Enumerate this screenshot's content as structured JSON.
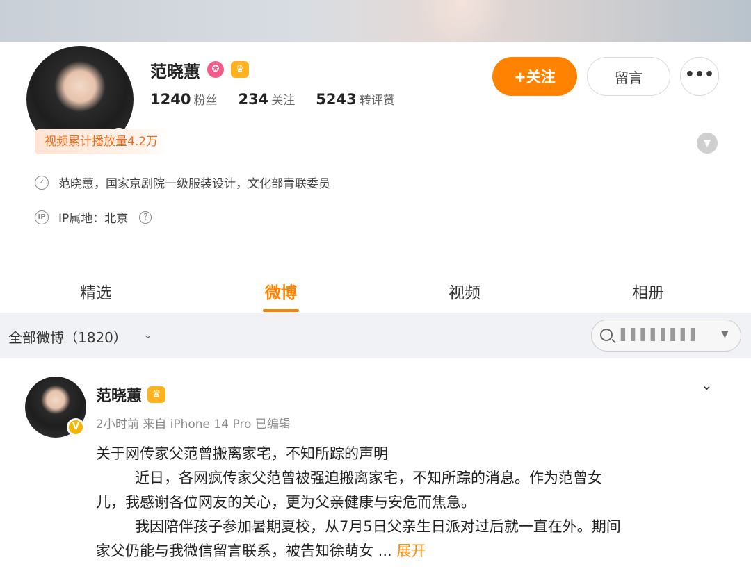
{
  "profile": {
    "name": "范晓蕙",
    "verified_mark": "V",
    "badges": [
      "pink-badge-icon",
      "crown-badge-icon"
    ],
    "stats": [
      {
        "value": "1240",
        "label": "粉丝"
      },
      {
        "value": "234",
        "label": "关注"
      },
      {
        "value": "5243",
        "label": "转评赞"
      }
    ],
    "follow_label": "+关注",
    "message_label": "留言",
    "more_label": "•••",
    "video_plays": "视频累计播放量4.2万",
    "bio": "范晓蕙，国家京剧院一级服装设计，文化部青联委员",
    "ip_location": "IP属地：北京"
  },
  "tabs": [
    {
      "label": "精选"
    },
    {
      "label": "微博"
    },
    {
      "label": "视频"
    },
    {
      "label": "相册"
    }
  ],
  "active_tab": "微博",
  "filter": {
    "label": "全部微博（1820）",
    "search_text": "▌▌▌▌▌▌▌▌"
  },
  "post": {
    "author": "范晓蕙",
    "meta": "2小时前  来自 iPhone 14 Pro 已编辑",
    "lines": [
      "关于网传家父范曾搬离家宅，不知所踪的声明",
      "近日，各网疯传家父范曾被强迫搬离家宅，不知所踪的消息。作为范曾女",
      "儿，我感谢各位网友的关心，更为父亲健康与安危而焦急。",
      "我因陪伴孩子参加暑期夏校，从7月5日父亲生日派对过后就一直在外。期间",
      "家父仍能与我微信留言联系，被告知徐萌女  ..."
    ],
    "expand_label": "展开"
  },
  "colors": {
    "accent": "#ff8200",
    "verified": "#f4b400",
    "badge_pink": "#f35c8a"
  }
}
